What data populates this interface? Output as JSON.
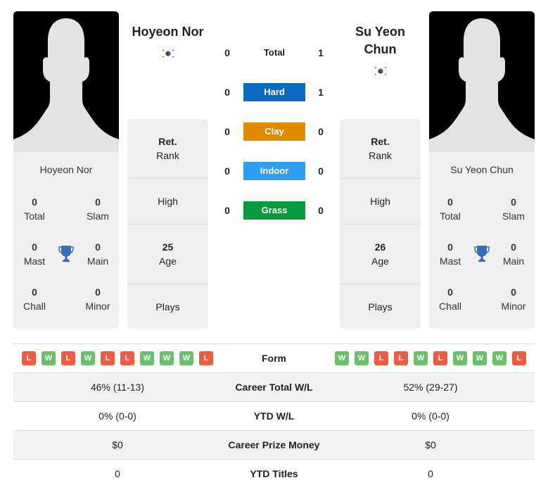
{
  "player1": {
    "name": "Hoyeon Nor",
    "header_name": "Hoyeon Nor",
    "flag_icon": "south-korea-flag-icon",
    "titles": {
      "total": {
        "value": "0",
        "label": "Total"
      },
      "slam": {
        "value": "0",
        "label": "Slam"
      },
      "mast": {
        "value": "0",
        "label": "Mast"
      },
      "main": {
        "value": "0",
        "label": "Main"
      },
      "chall": {
        "value": "0",
        "label": "Chall"
      },
      "minor": {
        "value": "0",
        "label": "Minor"
      }
    },
    "info": {
      "rank_value": "Ret.",
      "rank_label": "Rank",
      "high_label": "High",
      "age_value": "25",
      "age_label": "Age",
      "plays_label": "Plays"
    },
    "form": [
      "L",
      "W",
      "L",
      "W",
      "L",
      "L",
      "W",
      "W",
      "W",
      "L"
    ],
    "career_total_wl": "46% (11-13)",
    "ytd_wl": "0% (0-0)",
    "career_prize_money": "$0",
    "ytd_titles": "0"
  },
  "player2": {
    "name": "Su Yeon Chun",
    "header_name_line1": "Su Yeon",
    "header_name_line2": "Chun",
    "flag_icon": "south-korea-flag-icon",
    "titles": {
      "total": {
        "value": "0",
        "label": "Total"
      },
      "slam": {
        "value": "0",
        "label": "Slam"
      },
      "mast": {
        "value": "0",
        "label": "Mast"
      },
      "main": {
        "value": "0",
        "label": "Main"
      },
      "chall": {
        "value": "0",
        "label": "Chall"
      },
      "minor": {
        "value": "0",
        "label": "Minor"
      }
    },
    "info": {
      "rank_value": "Ret.",
      "rank_label": "Rank",
      "high_label": "High",
      "age_value": "26",
      "age_label": "Age",
      "plays_label": "Plays"
    },
    "form": [
      "W",
      "W",
      "L",
      "L",
      "W",
      "L",
      "W",
      "W",
      "W",
      "L"
    ],
    "career_total_wl": "52% (29-27)",
    "ytd_wl": "0% (0-0)",
    "career_prize_money": "$0",
    "ytd_titles": "0"
  },
  "h2h": {
    "total": {
      "label": "Total",
      "p1": "0",
      "p2": "1"
    },
    "surfaces": [
      {
        "label": "Hard",
        "p1": "0",
        "p2": "1",
        "color": "#0a6cc1"
      },
      {
        "label": "Clay",
        "p1": "0",
        "p2": "0",
        "color": "#e08a00"
      },
      {
        "label": "Indoor",
        "p1": "0",
        "p2": "0",
        "color": "#2f9ef0"
      },
      {
        "label": "Grass",
        "p1": "0",
        "p2": "0",
        "color": "#0a9a3e"
      }
    ]
  },
  "stats_labels": {
    "form": "Form",
    "career_total_wl": "Career Total W/L",
    "ytd_wl": "YTD W/L",
    "career_prize_money": "Career Prize Money",
    "ytd_titles": "YTD Titles"
  },
  "colors": {
    "win": "#6cbd6c",
    "loss": "#ec5b44",
    "trophy": "#3a6fb8"
  }
}
